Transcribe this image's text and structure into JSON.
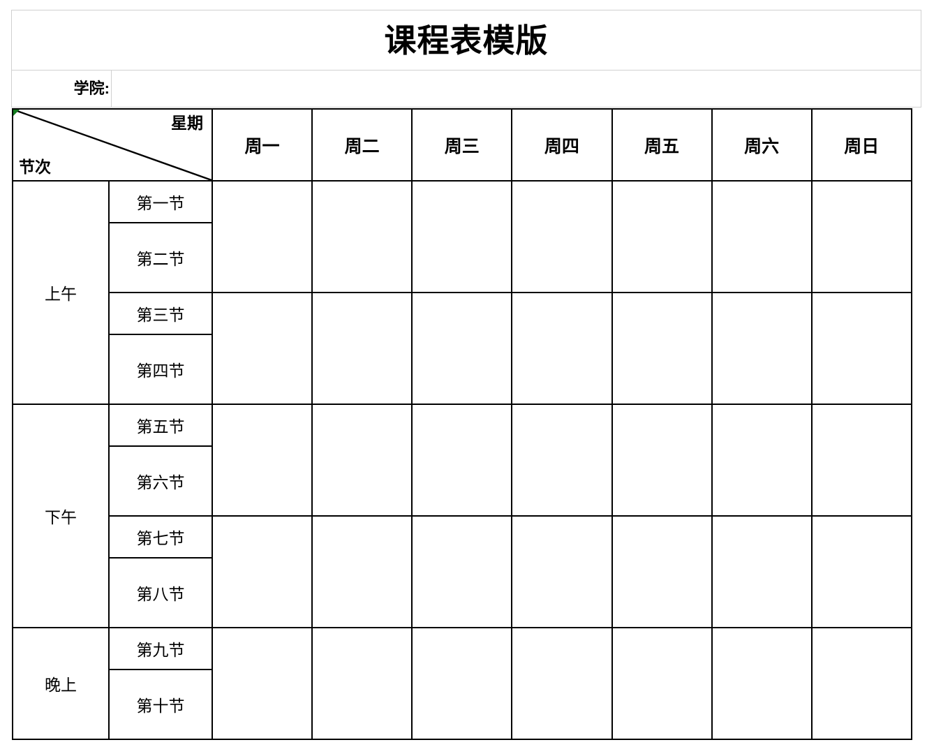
{
  "document": {
    "title": "课程表模版"
  },
  "info_row": {
    "college_label": "学院:",
    "college_value": ""
  },
  "table": {
    "corner": {
      "weekday_label": "星期",
      "period_label": "节次",
      "marker_color": "#127a1e"
    },
    "day_headers": [
      "周一",
      "周二",
      "周三",
      "周四",
      "周五",
      "周六",
      "周日"
    ],
    "sections": [
      {
        "name": "上午",
        "periods": [
          "第一节",
          "第二节",
          "第三节",
          "第四节"
        ]
      },
      {
        "name": "下午",
        "periods": [
          "第五节",
          "第六节",
          "第七节",
          "第八节"
        ]
      },
      {
        "name": "晚上",
        "periods": [
          "第九节",
          "第十节"
        ]
      }
    ],
    "cells": {
      "morning_1_2": [
        "",
        "",
        "",
        "",
        "",
        "",
        ""
      ],
      "morning_3_4": [
        "",
        "",
        "",
        "",
        "",
        "",
        ""
      ],
      "afternoon_5_6": [
        "",
        "",
        "",
        "",
        "",
        "",
        ""
      ],
      "afternoon_7_8": [
        "",
        "",
        "",
        "",
        "",
        "",
        ""
      ],
      "evening_9_10": [
        "",
        "",
        "",
        "",
        "",
        "",
        ""
      ]
    },
    "border_color": "#000000",
    "grid_color": "#d0d0d0"
  }
}
